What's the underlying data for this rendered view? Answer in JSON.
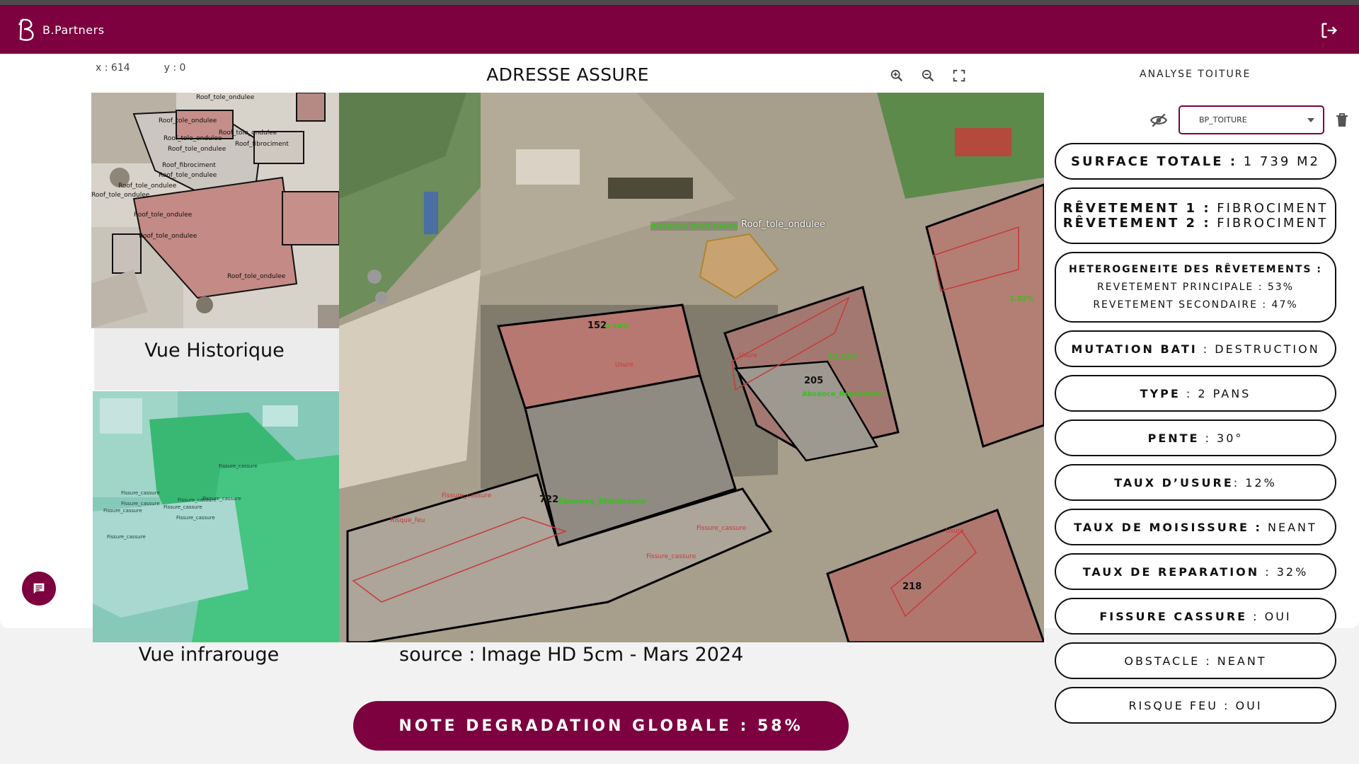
{
  "app": {
    "brand": "B.Partners"
  },
  "viewer": {
    "coord_x_label": "x :",
    "coord_x_value": "614",
    "coord_y_label": "y :",
    "coord_y_value": "0",
    "title": "ADRESSE ASSURE",
    "historic_label": "Vue Historique",
    "infrared_label": "Vue infrarouge",
    "source_label": "source : Image HD 5cm - Mars 2024",
    "historic_map_labels": [
      "Roof_tole_ondulee",
      "Roof_tole_ondulee",
      "Roof_tole_ondulee",
      "Roof_tole_ondulee",
      "Roof_fibrociment",
      "Roof_tole_ondulee",
      "Roof_fibrociment",
      "Roof_tole_ondulee",
      "Roof_tole_ondulee",
      "Roof_tole_ondulee",
      "Roof_tole_ondulee",
      "Roof_tole_ondulee",
      "Roof_tole_ondulee"
    ],
    "infrared_map_labels": [
      "Fissure_cassure",
      "Fissure_cassure",
      "Fissure_cassure",
      "Fissure_cassure",
      "Fissure_cassure",
      "Fissure_cassure",
      "Fissure_cassure",
      "Fissure_cassure",
      "Fissure_cassure"
    ],
    "main_map_labels": {
      "roof_top": "Roof_tole_ondulee",
      "absence_roof_usure": "Absence Roof usure",
      "b152": "152",
      "b152_pct": "0.54%",
      "b205": "205",
      "b205_pct": "13.11%",
      "absence_reparation": "Absence_Reparation",
      "b722": "722",
      "absence_moisissure": "Absence_Moisissure",
      "b218": "218",
      "right_pct": "1.32%",
      "risque_feu": "Risque_feu",
      "usure": "Usure",
      "fissure": "Fissure_cassure"
    }
  },
  "note": {
    "label": "NOTE DEGRADATION GLOBALE : 58%"
  },
  "panel": {
    "header": "ANALYSE TOITURE",
    "layer_select": "BP_TOITURE",
    "stats": [
      {
        "lines": [
          {
            "k": "SURFACE TOTALE :",
            "v": " 1 739 M2"
          }
        ],
        "size": "lg"
      },
      {
        "lines": [
          {
            "k": "RÊVETEMENT 1 :",
            "v": " FIBROCIMENT"
          },
          {
            "k": "RÊVETEMENT 2 :",
            "v": " FIBROCIMENT"
          }
        ],
        "size": "lg"
      },
      {
        "lines": [
          {
            "k": "HETEROGENEITE DES RÊVETEMENTS :",
            "v": ""
          },
          {
            "k": "",
            "v": "REVETEMENT PRINCIPALE : 53%"
          },
          {
            "k": "",
            "v": "REVETEMENT SECONDAIRE : 47%"
          }
        ],
        "size": "sm"
      },
      {
        "lines": [
          {
            "k": "MUTATION BATI",
            "v": " : DESTRUCTION"
          }
        ],
        "size": "md"
      },
      {
        "lines": [
          {
            "k": "TYPE",
            "v": " : 2 PANS"
          }
        ],
        "size": "md"
      },
      {
        "lines": [
          {
            "k": "PENTE",
            "v": " : 30°"
          }
        ],
        "size": "md"
      },
      {
        "lines": [
          {
            "k": "TAUX D’USURE",
            "v": ": 12%"
          }
        ],
        "size": "md"
      },
      {
        "lines": [
          {
            "k": "TAUX DE MOISISSURE :",
            "v": " NEANT"
          }
        ],
        "size": "md"
      },
      {
        "lines": [
          {
            "k": "TAUX DE REPARATION",
            "v": " : 32%"
          }
        ],
        "size": "md"
      },
      {
        "lines": [
          {
            "k": "FISSURE CASSURE",
            "v": " : OUI"
          }
        ],
        "size": "md"
      },
      {
        "lines": [
          {
            "k": "",
            "v": "OBSTACLE : NEANT"
          }
        ],
        "size": "md"
      },
      {
        "lines": [
          {
            "k": "",
            "v": "RISQUE FEU : OUI"
          }
        ],
        "size": "md"
      }
    ]
  },
  "colors": {
    "brand": "#7d003f",
    "annotation_green": "#36c21a",
    "damage_red": "#d02a2a"
  },
  "icons": {
    "logout": "logout-icon",
    "zoom_in": "zoom-in-icon",
    "zoom_out": "zoom-out-icon",
    "fullscreen": "fullscreen-icon",
    "visibility_off": "eye-off-icon",
    "trash": "trash-icon",
    "chat": "chat-icon",
    "dropdown": "chevron-down-icon"
  }
}
